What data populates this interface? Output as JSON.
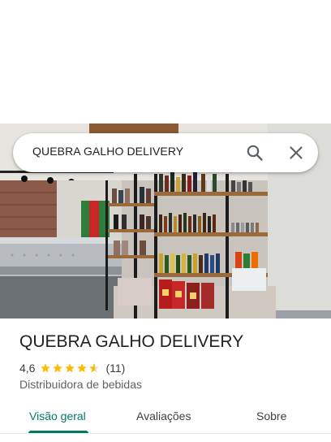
{
  "search": {
    "query": "QUEBRA GALHO DELIVERY"
  },
  "place": {
    "title": "QUEBRA GALHO DELIVERY",
    "rating": "4,6",
    "stars": 4.6,
    "reviews_count": "(11)",
    "category": "Distribuidora de bebidas"
  },
  "tabs": [
    {
      "label": "Visão geral",
      "active": true
    },
    {
      "label": "Avaliações",
      "active": false
    },
    {
      "label": "Sobre",
      "active": false
    }
  ],
  "icons": {
    "search": "search-icon",
    "close": "close-icon",
    "star": "star-icon"
  },
  "colors": {
    "accent": "#00796b",
    "star": "#fbbc04",
    "text_primary": "#202124",
    "text_secondary": "#5f6368"
  }
}
